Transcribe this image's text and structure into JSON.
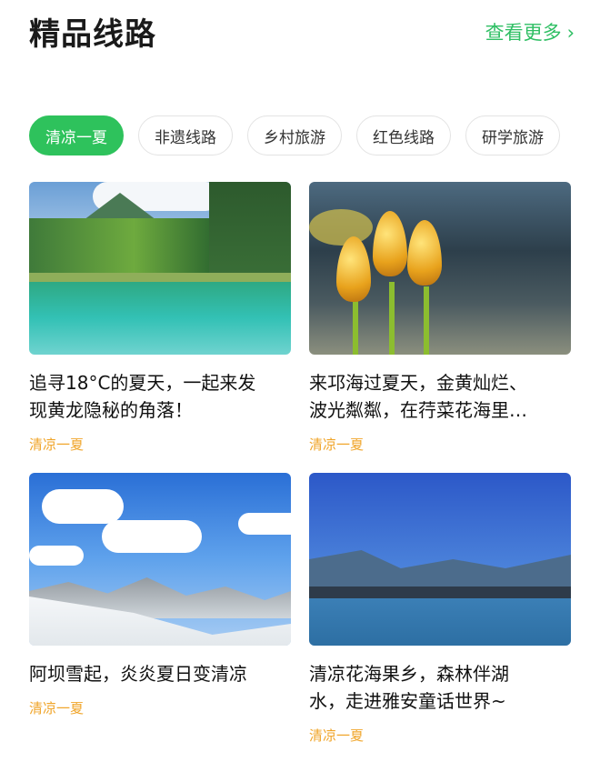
{
  "header": {
    "title": "精品线路",
    "more_label": "查看更多",
    "more_icon": "chevron-right-icon"
  },
  "tabs": [
    {
      "label": "清凉一夏",
      "active": true
    },
    {
      "label": "非遗线路",
      "active": false
    },
    {
      "label": "乡村旅游",
      "active": false
    },
    {
      "label": "红色线路",
      "active": false
    },
    {
      "label": "研学旅游",
      "active": false
    }
  ],
  "cards": [
    {
      "title_line1": "追寻18°C的夏天，一起来发",
      "title_line2": "现黄龙隐秘的角落！",
      "tag": "清凉一夏",
      "image": "lake-forest-photo"
    },
    {
      "title_line1": "来邛海过夏天，金黄灿烂、",
      "title_line2": "波光粼粼，在荇菜花海里…",
      "tag": "清凉一夏",
      "image": "lotus-buds-photo"
    },
    {
      "title_line1": "阿坝雪起，炎炎夏日变清凉",
      "title_line2": "",
      "tag": "清凉一夏",
      "image": "snow-mountains-photo"
    },
    {
      "title_line1": "清凉花海果乡，森林伴湖",
      "title_line2": "水，走进雅安童话世界~",
      "tag": "清凉一夏",
      "image": "blue-lake-photo"
    }
  ],
  "colors": {
    "accent_green": "#2ec25c",
    "tag_orange": "#f0a52a"
  }
}
